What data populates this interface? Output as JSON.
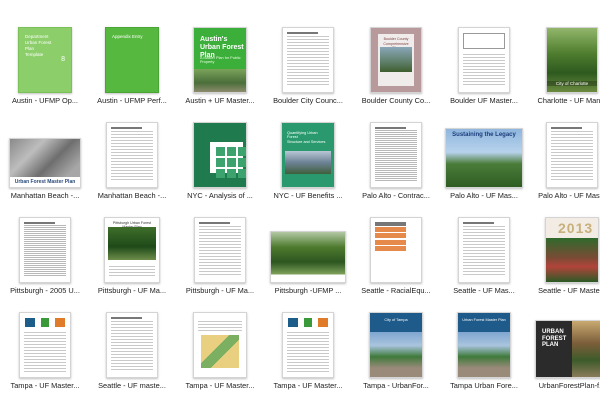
{
  "files": [
    {
      "caption": "Austin - UFMP Op...",
      "style": "green1",
      "cover_text": "Department\nUrban Forest Plan\nTemplate",
      "cover_number": "8"
    },
    {
      "caption": "Austin - UFMP Perf...",
      "style": "green2",
      "cover_text": "Appendix Entry"
    },
    {
      "caption": "Austin + UF Master...",
      "style": "aust",
      "cover_title": "Austin's\nUrban Forest Plan",
      "cover_sub": "A Master Plan for Public Property"
    },
    {
      "caption": "Boulder City Counc...",
      "style": "doc"
    },
    {
      "caption": "Boulder County Co...",
      "style": "pink",
      "cover_title": "Boulder County\nComprehensive\nPlan"
    },
    {
      "caption": "Boulder UF Master...",
      "style": "docbox"
    },
    {
      "caption": "Charlotte - UF Man...",
      "style": "charlotte",
      "cover_title": "City of Charlotte"
    },
    {
      "caption": "Manhattan Beach -...",
      "style": "aerial",
      "cover_title": "Urban Forest Master Plan"
    },
    {
      "caption": "Manhattan Beach -...",
      "style": "doc"
    },
    {
      "caption": "NYC - Analysis of ...",
      "style": "nyc1"
    },
    {
      "caption": "NYC - UF Benefits ...",
      "style": "nyc2",
      "cover_title": "Quantifying Urban Forest\nStructure and Services"
    },
    {
      "caption": "Palo Alto - Contrac...",
      "style": "docdense"
    },
    {
      "caption": "Palo Alto - UF Mas...",
      "style": "palo",
      "cover_title": "Sustaining the Legacy"
    },
    {
      "caption": "Palo Alto - UF Mas...",
      "style": "doc"
    },
    {
      "caption": "Pittsburgh - 2005 U...",
      "style": "docdense"
    },
    {
      "caption": "Pittsburgh - UF Ma...",
      "style": "pittsb",
      "cover_title": "Pittsburgh Urban Forest Master Plan"
    },
    {
      "caption": "Pittsburgh - UF Ma...",
      "style": "doc"
    },
    {
      "caption": "Pittsburgh -UFMP ...",
      "style": "treebig"
    },
    {
      "caption": "Seattle - RacialEqu...",
      "style": "orange"
    },
    {
      "caption": "Seattle - UF Mas...",
      "style": "doc"
    },
    {
      "caption": "Seattle - UF Maste...",
      "style": "seattle2013",
      "cover_year": "2013"
    },
    {
      "caption": "Tampa - UF Master...",
      "style": "logos"
    },
    {
      "caption": "Seattle - UF maste...",
      "style": "doc"
    },
    {
      "caption": "Tampa - UF Master...",
      "style": "map"
    },
    {
      "caption": "Tampa - UF Master...",
      "style": "logos"
    },
    {
      "caption": "Tampa - UrbanFor...",
      "style": "plaza",
      "cover_title": "City of Tampa"
    },
    {
      "caption": "Tampa Urban Fore...",
      "style": "plaza",
      "cover_title": "Urban Forest Master Plan"
    },
    {
      "caption": "UrbanForestPlan-f...",
      "style": "dark",
      "cover_title": "URBAN\nFOREST\nPLAN"
    }
  ]
}
